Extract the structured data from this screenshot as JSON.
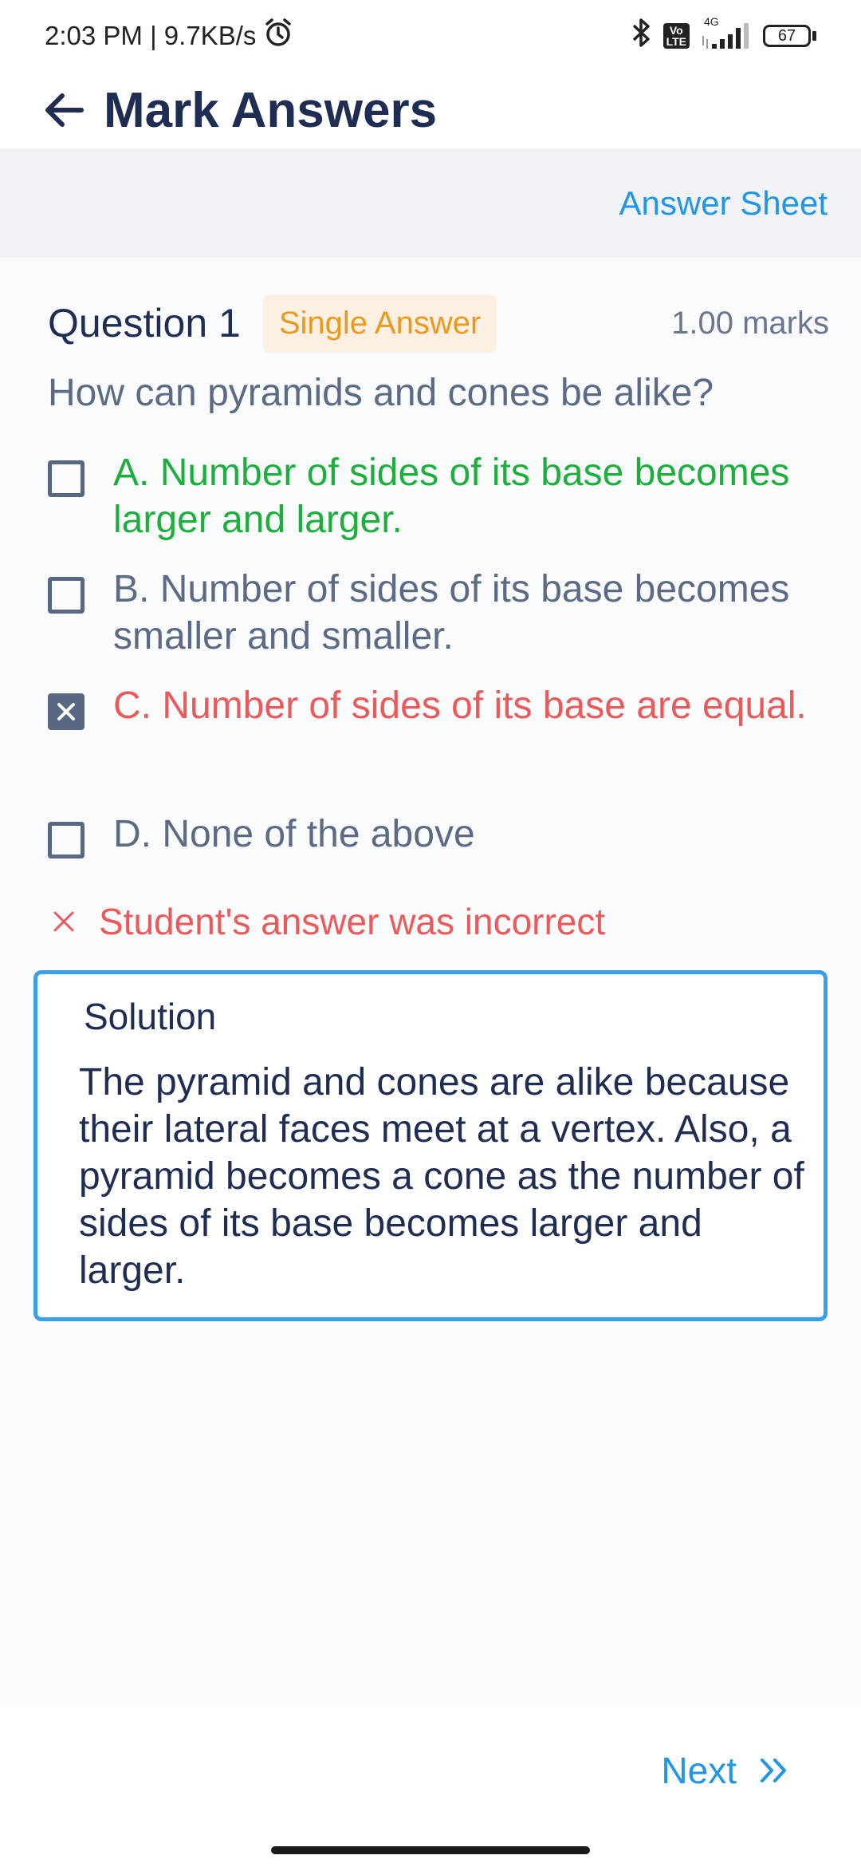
{
  "status_bar": {
    "time": "2:03 PM | 9.7KB/s",
    "network": "4G",
    "volte": "Vo\nLTE",
    "battery": "67",
    "icons": [
      "alarm-icon",
      "bluetooth-icon",
      "volte-icon",
      "signal-icon",
      "battery-icon"
    ]
  },
  "header": {
    "title": "Mark Answers",
    "back_icon": "arrow-left-icon"
  },
  "toolbar": {
    "answer_sheet_label": "Answer Sheet"
  },
  "question": {
    "number_label": "Question 1",
    "type_label": "Single Answer",
    "marks_label": "1.00 marks",
    "text": "How can pyramids and cones be alike?",
    "options": [
      {
        "label": "A. Number of sides of its base becomes larger and larger.",
        "state": "correct",
        "checked": false
      },
      {
        "label": "B. Number of sides of its base becomes smaller and smaller.",
        "state": "normal",
        "checked": false
      },
      {
        "label": "C. Number of sides of its base are equal.",
        "state": "incorrect",
        "checked": true
      },
      {
        "label": "D. None of the above",
        "state": "normal",
        "checked": false
      }
    ]
  },
  "result": {
    "text": "Student's answer was incorrect",
    "icon": "close-icon"
  },
  "solution": {
    "title": "Solution",
    "body": "The pyramid and cones are alike because their lateral faces meet at a vertex. Also, a pyramid becomes a cone as the number of sides of its base becomes larger and larger."
  },
  "footer": {
    "next_label": "Next",
    "next_icon": "double-chevron-right-icon"
  },
  "colors": {
    "accent": "#2196e6",
    "correct": "#1eae3e",
    "incorrect": "#ea5a5a",
    "badge_bg": "#fdf0e3",
    "badge_text": "#e89a1f",
    "title": "#1f2d52"
  }
}
